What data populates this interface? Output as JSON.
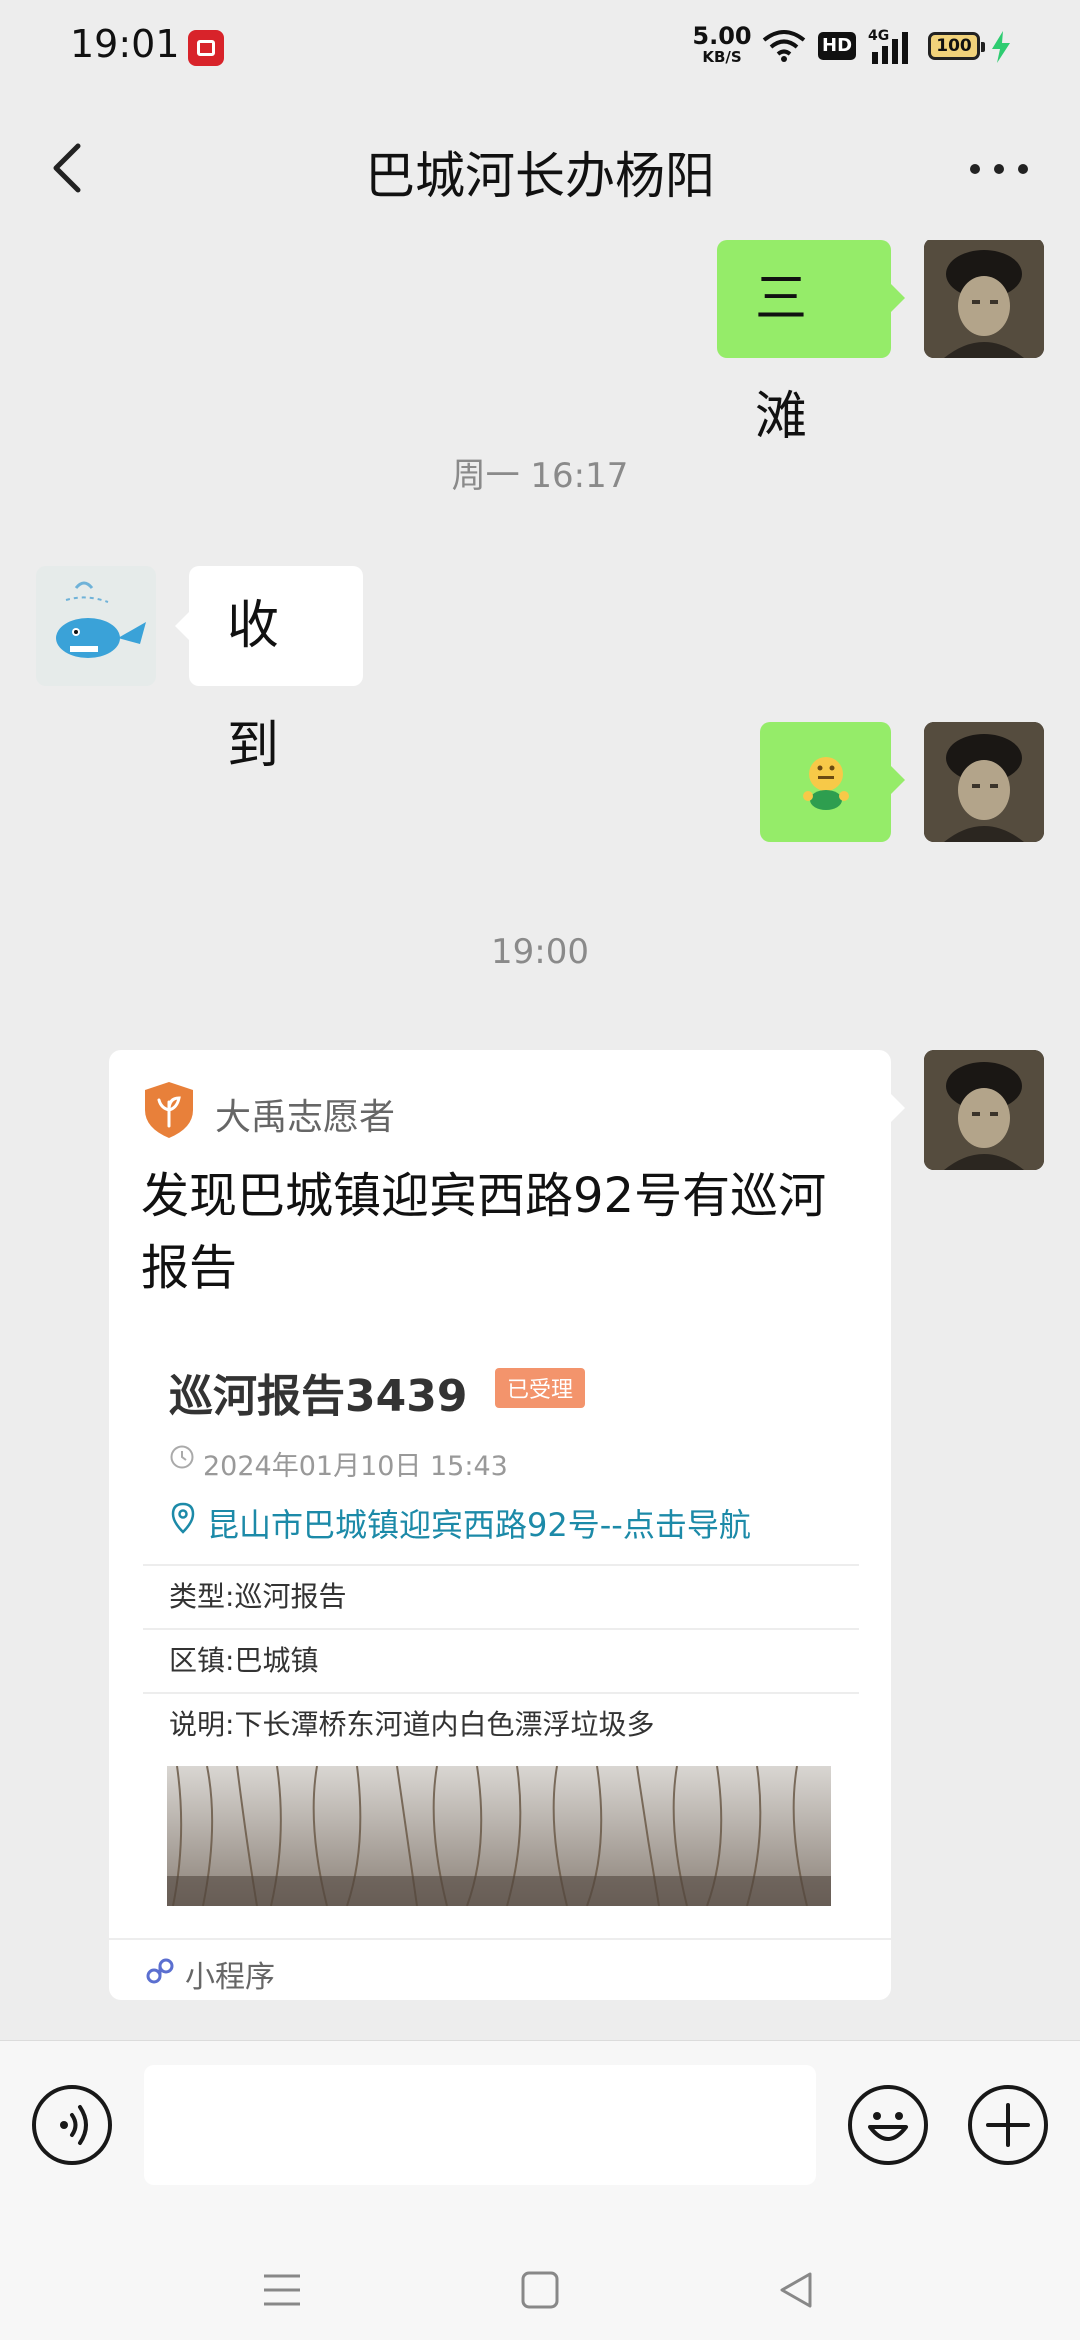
{
  "status_bar": {
    "time": "19:01",
    "net_speed_value": "5.00",
    "net_speed_unit": "KB/S",
    "hd_label": "HD",
    "network_type": "4G",
    "battery_level": "100"
  },
  "header": {
    "title": "巴城河长办杨阳"
  },
  "messages": [
    {
      "side": "right",
      "type": "text",
      "text": "三滩"
    },
    {
      "type": "timestamp",
      "text": "周一 16:17"
    },
    {
      "side": "left",
      "type": "text",
      "text": "收到"
    },
    {
      "side": "right",
      "type": "emoji",
      "emoji": "🤐"
    },
    {
      "type": "timestamp",
      "text": "19:00"
    }
  ],
  "mini_program_card": {
    "brand": "大禹志愿者",
    "title": "发现巴城镇迎宾西路92号有巡河报告",
    "report_title": "巡河报告3439",
    "status_badge": "已受理",
    "datetime": "2024年01月10日 15:43",
    "location_link": "昆山市巴城镇迎宾西路92号--点击导航",
    "fields": [
      {
        "label": "类型:",
        "value": "巡河报告"
      },
      {
        "label": "区镇:",
        "value": "巴城镇"
      },
      {
        "label": "说明:",
        "value": "下长潭桥东河道内白色漂浮垃圾多"
      }
    ],
    "footer_label": "小程序"
  },
  "input_bar": {
    "text_value": ""
  },
  "colors": {
    "my_bubble": "#95ec69",
    "their_bubble": "#ffffff",
    "link": "#1c8aa8",
    "badge": "#f3946c",
    "brand_orange": "#e8803a"
  }
}
